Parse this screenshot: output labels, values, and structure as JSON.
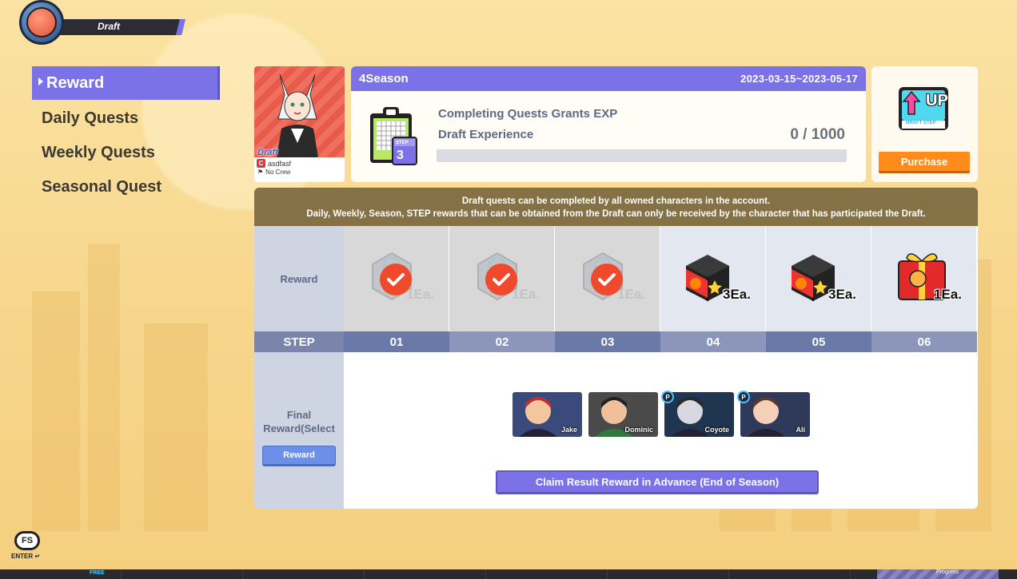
{
  "mode_badge": {
    "label": "Draft"
  },
  "menu": {
    "items": [
      {
        "label": "Reward",
        "active": true
      },
      {
        "label": "Daily Quests",
        "active": false
      },
      {
        "label": "Weekly Quests",
        "active": false
      },
      {
        "label": "Seasonal Quest",
        "active": false
      }
    ]
  },
  "character": {
    "draft_tag": "Draft",
    "name": "asdfasf",
    "crew_badge": "C",
    "crew": "No Crew"
  },
  "season": {
    "title": "4Season",
    "date_range": "2023-03-15~2023-05-17",
    "step_label": "STEP",
    "step_number": "3",
    "exp_title": "Completing Quests Grants EXP",
    "exp_subtitle": "Draft Experience",
    "exp_count": "0 / 1000",
    "exp_progress": 0
  },
  "purchase": {
    "icon_text": "UP",
    "icon_subtext": "DRAFT STEP",
    "button": "Purchase"
  },
  "notice": {
    "line1": "Draft quests can be completed by all owned characters in the account.",
    "line2": "Daily, Weekly, Season, STEP rewards that can be obtained from the Draft can only be received by the character that has participated the Draft."
  },
  "table": {
    "reward_label": "Reward",
    "step_label": "STEP",
    "final_label": "Final Reward(Select",
    "final_button": "Reward",
    "steps": [
      {
        "num": "01",
        "qty": "1Ea.",
        "claimed": true,
        "icon": "badge-icon"
      },
      {
        "num": "02",
        "qty": "1Ea.",
        "claimed": true,
        "icon": "badge-icon"
      },
      {
        "num": "03",
        "qty": "1Ea.",
        "claimed": true,
        "icon": "badge-icon"
      },
      {
        "num": "04",
        "qty": "3Ea.",
        "claimed": false,
        "icon": "mystery-box-icon"
      },
      {
        "num": "05",
        "qty": "3Ea.",
        "claimed": false,
        "icon": "mystery-box-icon"
      },
      {
        "num": "06",
        "qty": "1Ea.",
        "claimed": false,
        "icon": "gift-box-icon"
      }
    ]
  },
  "final_rewards": [
    {
      "name": "Jake",
      "badge": ""
    },
    {
      "name": "Dominic",
      "badge": ""
    },
    {
      "name": "Coyote",
      "badge": "P"
    },
    {
      "name": "Ali",
      "badge": "P"
    }
  ],
  "claim_button": "Claim Result Reward in Advance (End of Season)",
  "fs_logo": {
    "text": "FS",
    "enter": "ENTER"
  },
  "taskbar": {
    "free_label": "FREE",
    "progress_label": "Progress"
  }
}
